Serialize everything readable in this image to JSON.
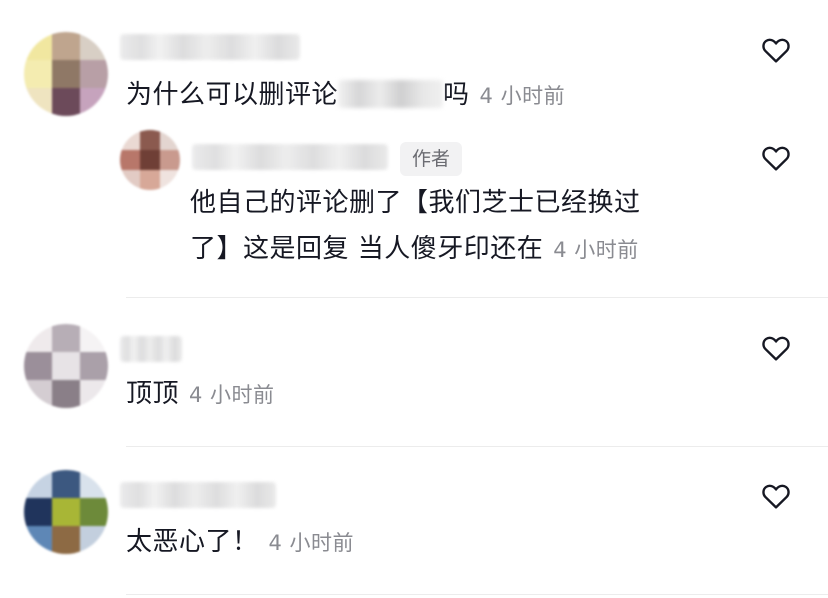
{
  "comments": [
    {
      "text_before": "为什么可以删评论",
      "text_after": "吗",
      "time": "4 小时前",
      "liked": false
    },
    {
      "reply": true,
      "badge": "作者",
      "text_line1": "他自己的评论删了【我们芝士已经换过",
      "text_line2": "了】这是回复 当人傻牙印还在",
      "time": "4 小时前",
      "liked": false
    },
    {
      "text": "顶顶",
      "time": "4 小时前",
      "liked": false
    },
    {
      "text": "太恶心了！",
      "time": "4 小时前",
      "liked": false
    }
  ],
  "icons": {
    "like": "heart-outline-icon"
  },
  "colors": {
    "text": "#161823",
    "meta": "#8a8b91",
    "badge_bg": "#f2f2f3",
    "divider": "#ececec"
  }
}
